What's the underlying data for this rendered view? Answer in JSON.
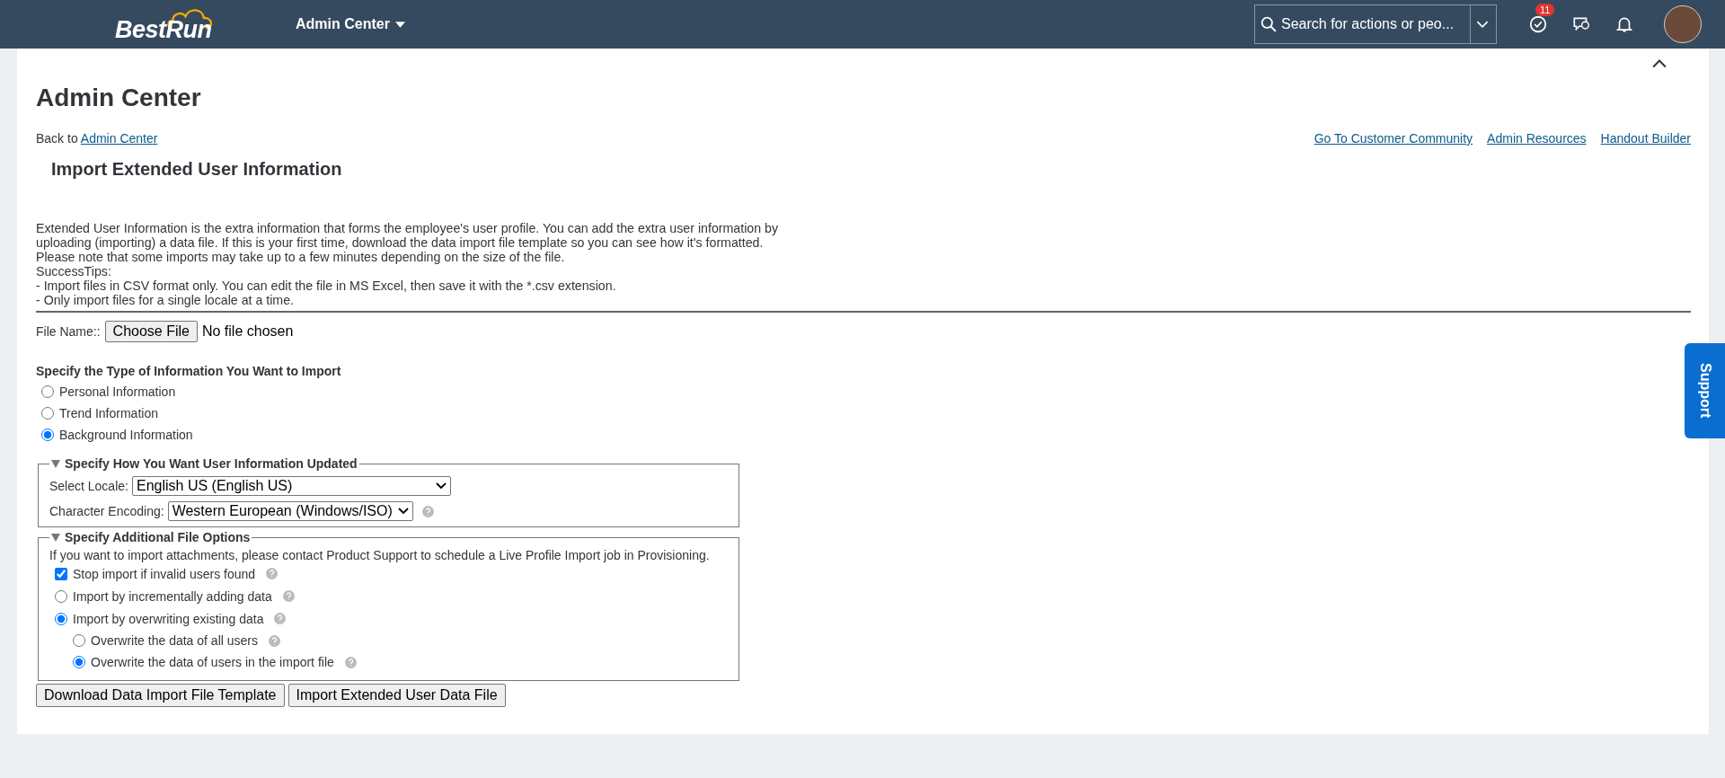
{
  "header": {
    "logo": "BestRun",
    "menu": "Admin Center",
    "search_placeholder": "Search for actions or peo...",
    "notification_count": "11"
  },
  "page": {
    "title": "Admin Center",
    "back_prefix": "Back to",
    "back_link": "Admin Center",
    "links": [
      "Go To Customer Community",
      "Admin Resources",
      "Handout Builder"
    ],
    "section_title": "Import Extended User Information",
    "description": [
      "Extended User Information is the extra information that forms the employee's user profile. You can add the extra user information by",
      "uploading (importing) a data file. If this is your first time, download the data import file template so you can see how it's formatted.",
      "Please note that some imports may take up to a few minutes depending on the size of the file.",
      "SuccessTips:",
      "- Import files in CSV format only. You can edit the file in MS Excel, then save it with the *.csv extension.",
      "- Only import files for a single locale at a time."
    ]
  },
  "file": {
    "label": "File Name::",
    "button": "Choose File",
    "status": "No file chosen"
  },
  "info_type": {
    "heading": "Specify the Type of Information You Want to Import",
    "options": [
      {
        "label": "Personal Information",
        "selected": false
      },
      {
        "label": "Trend Information",
        "selected": false
      },
      {
        "label": "Background Information",
        "selected": true
      }
    ]
  },
  "update_section": {
    "legend": "Specify How You Want User Information Updated",
    "expanded": true,
    "locale": {
      "label": "Select Locale:",
      "value": "English US (English US)"
    },
    "encoding": {
      "label": "Character Encoding:",
      "value": "Western European (Windows/ISO)",
      "help": true
    }
  },
  "file_options": {
    "legend": "Specify Additional File Options",
    "expanded": true,
    "note": "If you want to import attachments, please contact Product Support to schedule a Live Profile Import job in Provisioning.",
    "options": [
      {
        "kind": "checkbox",
        "label": "Stop import if invalid users found",
        "checked": true,
        "help": true
      },
      {
        "kind": "radio",
        "label": "Import by incrementally adding data",
        "selected": false,
        "help": true
      },
      {
        "kind": "radio",
        "label": "Import by overwriting existing data",
        "selected": true,
        "help": true,
        "children": [
          {
            "kind": "radio",
            "label": "Overwrite the data of all users",
            "selected": false,
            "help": true
          },
          {
            "kind": "radio",
            "label": "Overwrite the data of users in the import file",
            "selected": true,
            "help": true
          }
        ]
      }
    ]
  },
  "buttons": [
    "Download Data Import File Template",
    "Import Extended User Data File"
  ],
  "support_tab": "Support"
}
